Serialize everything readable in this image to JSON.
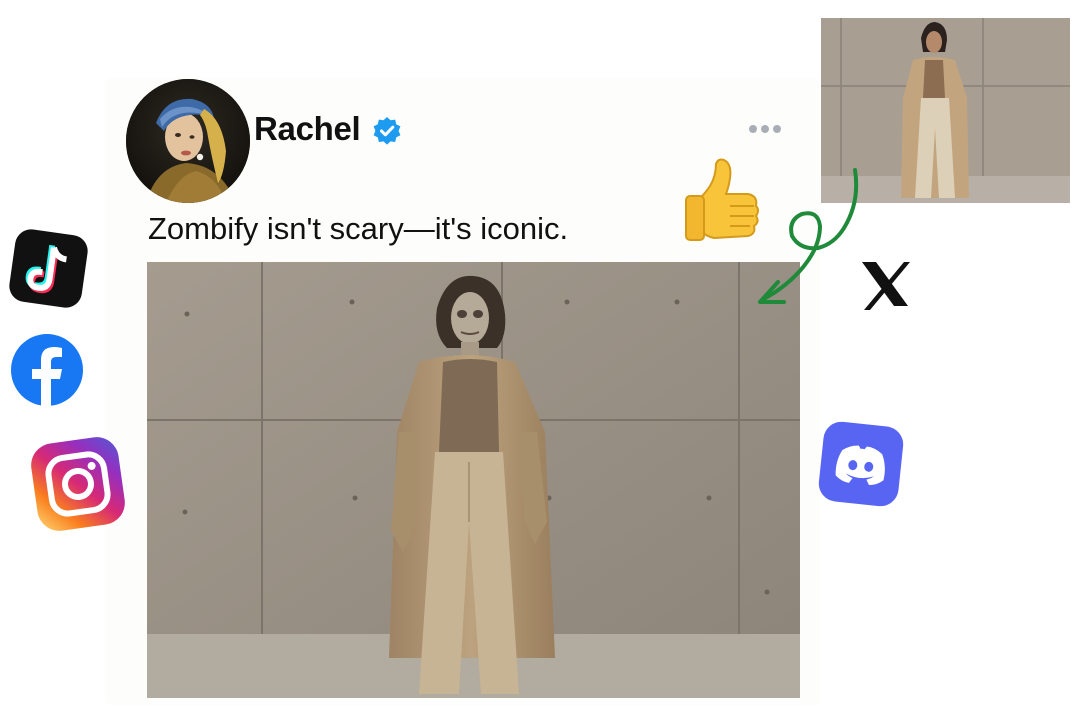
{
  "post": {
    "username": "Rachel",
    "text": "Zombify isn't scary—it's iconic.",
    "verified": true
  },
  "icons": {
    "avatar": "girl-with-pearl-earring-portrait",
    "verified": "verified-badge-icon",
    "more": "more-options-icon",
    "thumbs_up": "thumbs-up-emoji",
    "arrow": "curly-arrow",
    "platforms": [
      "tiktok-icon",
      "facebook-icon",
      "instagram-icon",
      "x-icon",
      "discord-icon"
    ]
  },
  "colors": {
    "verified_blue": "#1d9bf0",
    "arrow_green": "#1f8a3a",
    "tiktok_bg": "#111111",
    "facebook_blue": "#1877f2",
    "discord_blurple": "#5865f2"
  }
}
